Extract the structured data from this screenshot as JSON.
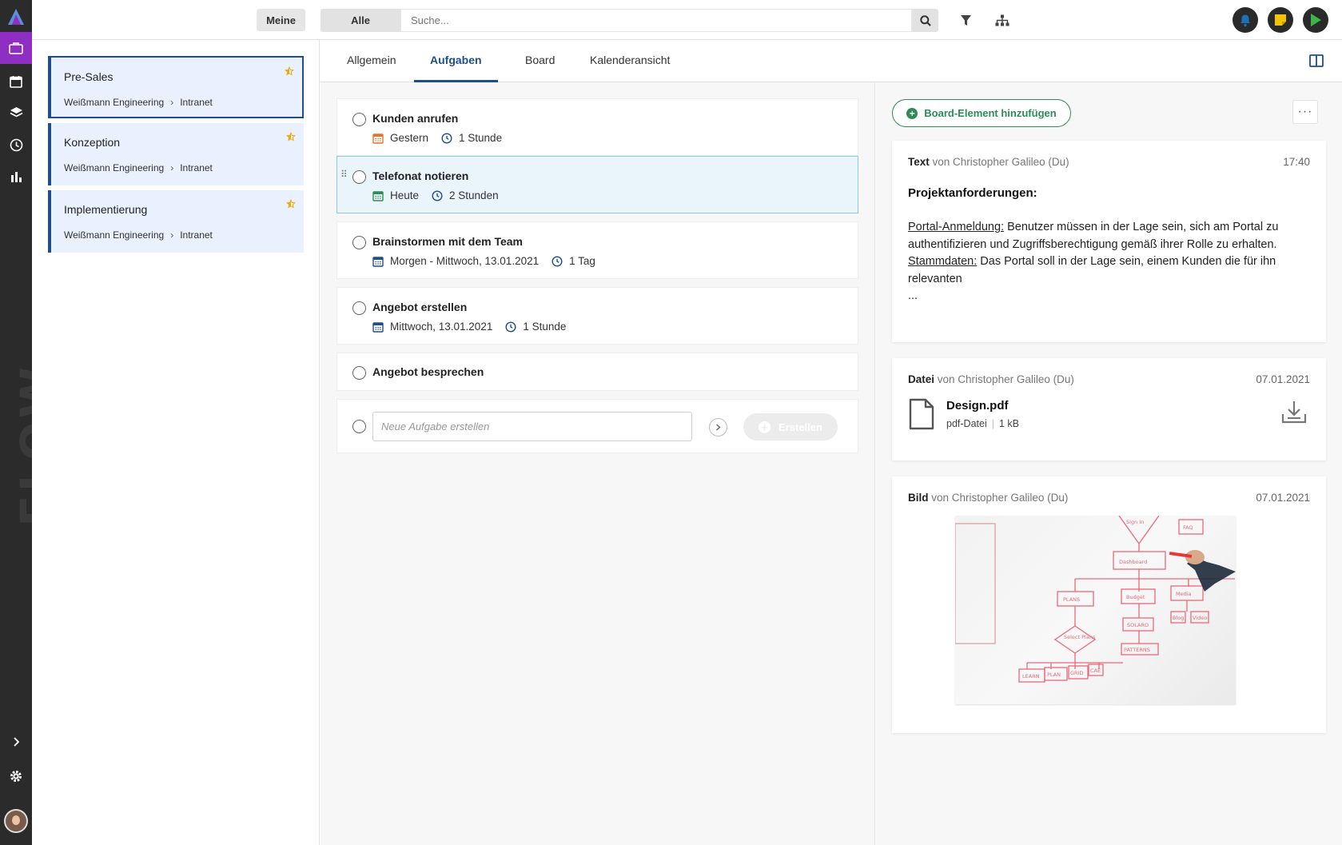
{
  "app": {
    "brand_watermark": "FLOW"
  },
  "rail": {
    "items": [
      {
        "icon": "briefcase-icon",
        "active": true
      },
      {
        "icon": "calendar-icon",
        "active": false
      },
      {
        "icon": "layers-icon",
        "active": false
      },
      {
        "icon": "clock-icon",
        "active": false
      },
      {
        "icon": "bar-chart-icon",
        "active": false
      }
    ],
    "bottom": [
      "chevron-right-icon",
      "gear-icon",
      "avatar"
    ]
  },
  "topbar": {
    "meine_label": "Meine",
    "scope_label": "Alle",
    "search_placeholder": "Suche...",
    "icons": [
      "search-icon",
      "filter-icon",
      "hierarchy-icon",
      "bell-icon",
      "sticky-note-icon",
      "play-icon"
    ],
    "colors": {
      "bell": "#1e6fb5",
      "note": "#f5c400",
      "play": "#3bb54a"
    }
  },
  "projects": [
    {
      "title": "Pre-Sales",
      "company": "Weißmann Engineering",
      "area": "Intranet",
      "starred": true,
      "active": true
    },
    {
      "title": "Konzeption",
      "company": "Weißmann Engineering",
      "area": "Intranet",
      "starred": true,
      "active": false
    },
    {
      "title": "Implementierung",
      "company": "Weißmann Engineering",
      "area": "Intranet",
      "starred": true,
      "active": false
    }
  ],
  "tabs": [
    {
      "label": "Allgemein",
      "active": false
    },
    {
      "label": "Aufgaben",
      "active": true
    },
    {
      "label": "Board",
      "active": false
    },
    {
      "label": "Kalenderansicht",
      "active": false
    }
  ],
  "tasks": [
    {
      "title": "Kunden anrufen",
      "date": "Gestern",
      "duration": "1 Stunde",
      "date_color": "#e8722a"
    },
    {
      "title": "Telefonat notieren",
      "date": "Heute",
      "duration": "2 Stunden",
      "date_color": "#2e8b57",
      "selected": true
    },
    {
      "title": "Brainstormen mit dem Team",
      "date": "Morgen - Mittwoch, 13.01.2021",
      "duration": "1 Tag",
      "date_color": "#1f4f8b"
    },
    {
      "title": "Angebot erstellen",
      "date": "Mittwoch, 13.01.2021",
      "duration": "1 Stunde",
      "date_color": "#1f4f8b"
    },
    {
      "title": "Angebot besprechen"
    }
  ],
  "new_task": {
    "placeholder": "Neue Aufgabe erstellen",
    "create_label": "Erstellen"
  },
  "board": {
    "add_label": "Board-Element hinzufügen",
    "more_label": "···",
    "text_card": {
      "type": "Text",
      "author": "von Christopher Galileo (Du)",
      "time": "17:40",
      "heading": "Projektanforderungen:",
      "p1_label": "Portal-Anmeldung:",
      "p1_text": " Benutzer müssen in der Lage sein, sich am Portal zu authentifizieren und Zugriffsberechtigung gemäß ihrer Rolle zu erhalten.",
      "p2_label": "Stammdaten:",
      "p2_text": " Das Portal soll in der Lage sein, einem Kunden die für ihn  relevanten",
      "ellipsis": "..."
    },
    "file_card": {
      "type": "Datei",
      "author": "von Christopher Galileo (Du)",
      "date": "07.01.2021",
      "filename": "Design.pdf",
      "filetype": "pdf-Datei",
      "filesize": "1 kB"
    },
    "image_card": {
      "type": "Bild",
      "author": "von Christopher Galileo (Du)",
      "date": "07.01.2021",
      "image_labels": [
        "Sign In",
        "FAQ",
        "Dashboard",
        "PLANS",
        "Budget",
        "Media",
        "Select Plans",
        "SOLARO",
        "Blog",
        "Video",
        "PATTERNS",
        "LEARN",
        "PLAN",
        "GRID",
        "CAE"
      ]
    }
  }
}
